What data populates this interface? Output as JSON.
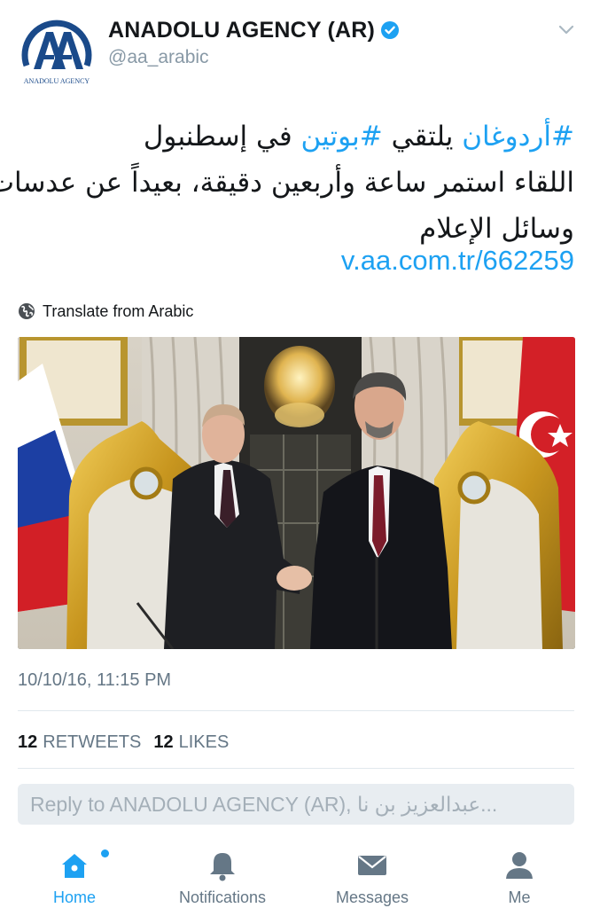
{
  "account": {
    "display_name": "ANADOLU AGENCY (AR)",
    "handle": "@aa_arabic",
    "logo_letters": "AA",
    "logo_caption": "ANADOLU AGENCY"
  },
  "tweet": {
    "hashtag_1": "#أردوغان",
    "text_1a": " يلتقي ",
    "hashtag_2": "#بوتين",
    "text_1b": " في إسطنبول",
    "line_2": "اللقاء استمر ساعة وأربعين دقيقة، بعيداً عن عدسات",
    "line_3": "وسائل الإعلام",
    "link": "v.aa.com.tr/662259"
  },
  "translate_label": "Translate from Arabic",
  "timestamp": "10/10/16, 11:15 PM",
  "stats": {
    "retweets_count": "12",
    "retweets_label": "RETWEETS",
    "likes_count": "12",
    "likes_label": "LIKES"
  },
  "reply": {
    "placeholder": "Reply to ANADOLU AGENCY (AR), عبدالعزيز بن نا..."
  },
  "tabbar": [
    {
      "label": "Home",
      "icon": "home-icon",
      "active": true
    },
    {
      "label": "Notifications",
      "icon": "bell-icon",
      "active": false
    },
    {
      "label": "Messages",
      "icon": "envelope-icon",
      "active": false
    },
    {
      "label": "Me",
      "icon": "person-icon",
      "active": false
    }
  ],
  "colors": {
    "accent": "#1da1f2",
    "text": "#14171a",
    "muted": "#657786",
    "logo": "#1a4a8a"
  }
}
